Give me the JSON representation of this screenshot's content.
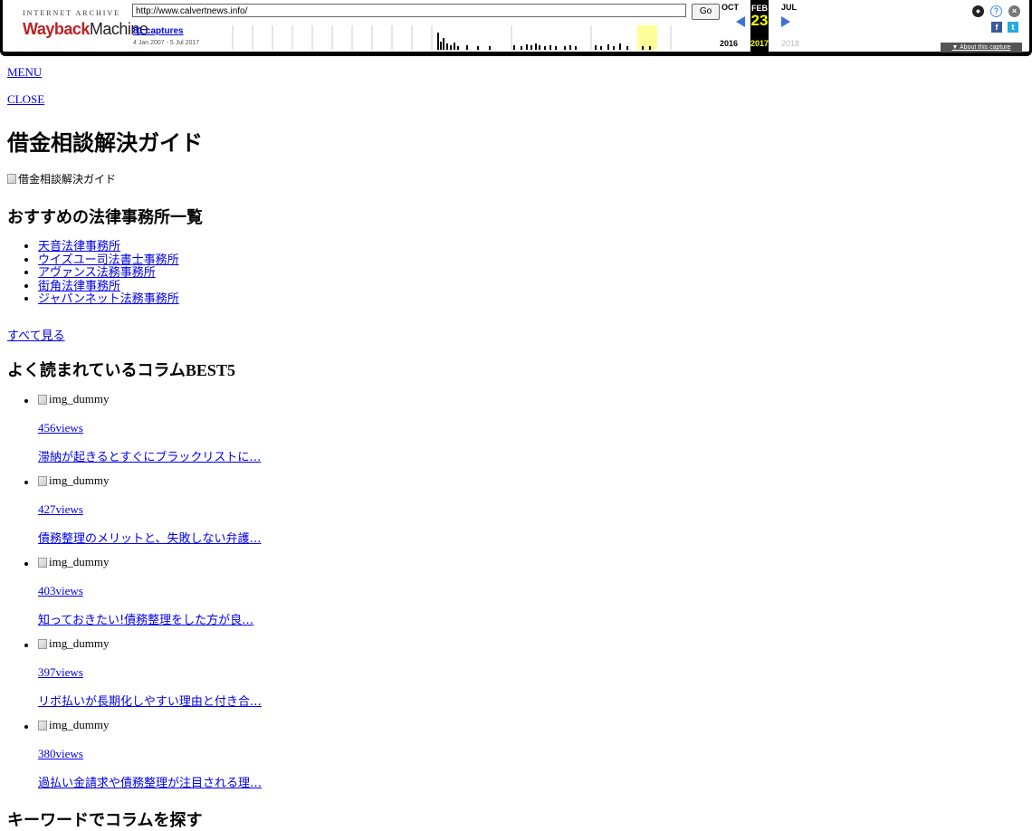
{
  "wayback": {
    "logo_top": "INTERNET ARCHIVE",
    "logo_way": "Wayback",
    "logo_machine": "Machine",
    "url": "http://www.calvertnews.info/",
    "go_label": "Go",
    "captures": "81 captures",
    "range": "4 Jan 2007 - 5 Jul 2017",
    "prev_month": "OCT",
    "cur_month": "FEB",
    "next_month": "JUL",
    "cur_day": "23",
    "prev_year": "2016",
    "cur_year": "2017",
    "next_year": "2018",
    "about": "▼ About this capture",
    "colors": {
      "highlight": "#ffff99",
      "current_bg": "#000000",
      "current_text": "#ffff00",
      "arrow": "#3d6fd6"
    }
  },
  "page": {
    "menu": "MENU",
    "close": "CLOSE",
    "title": "借金相談解決ガイド",
    "logo_alt": "借金相談解決ガイド",
    "section1": "おすすめの法律事務所一覧",
    "firms": [
      "天音法律事務所",
      "ウイズユー司法書士事務所",
      "アヴァンス法務事務所",
      "街角法律事務所",
      "ジャパンネット法務事務所"
    ],
    "see_all": "すべて見る",
    "section2_jp": "よく読まれているコラム",
    "section2_en": "BEST5",
    "columns": [
      {
        "img_alt": "img_dummy",
        "views": "456views",
        "title": "滞納が起きるとすぐにブラックリストに…"
      },
      {
        "img_alt": "img_dummy",
        "views": "427views",
        "title": "債務整理のメリットと、失敗しない弁護…"
      },
      {
        "img_alt": "img_dummy",
        "views": "403views",
        "title": "知っておきたい!債務整理をした方が良…"
      },
      {
        "img_alt": "img_dummy",
        "views": "397views",
        "title": "リボ払いが長期化しやすい理由と付き合…"
      },
      {
        "img_alt": "img_dummy",
        "views": "380views",
        "title": "過払い金請求や債務整理が注目される理…"
      }
    ],
    "section3": "キーワードでコラムを探す"
  }
}
